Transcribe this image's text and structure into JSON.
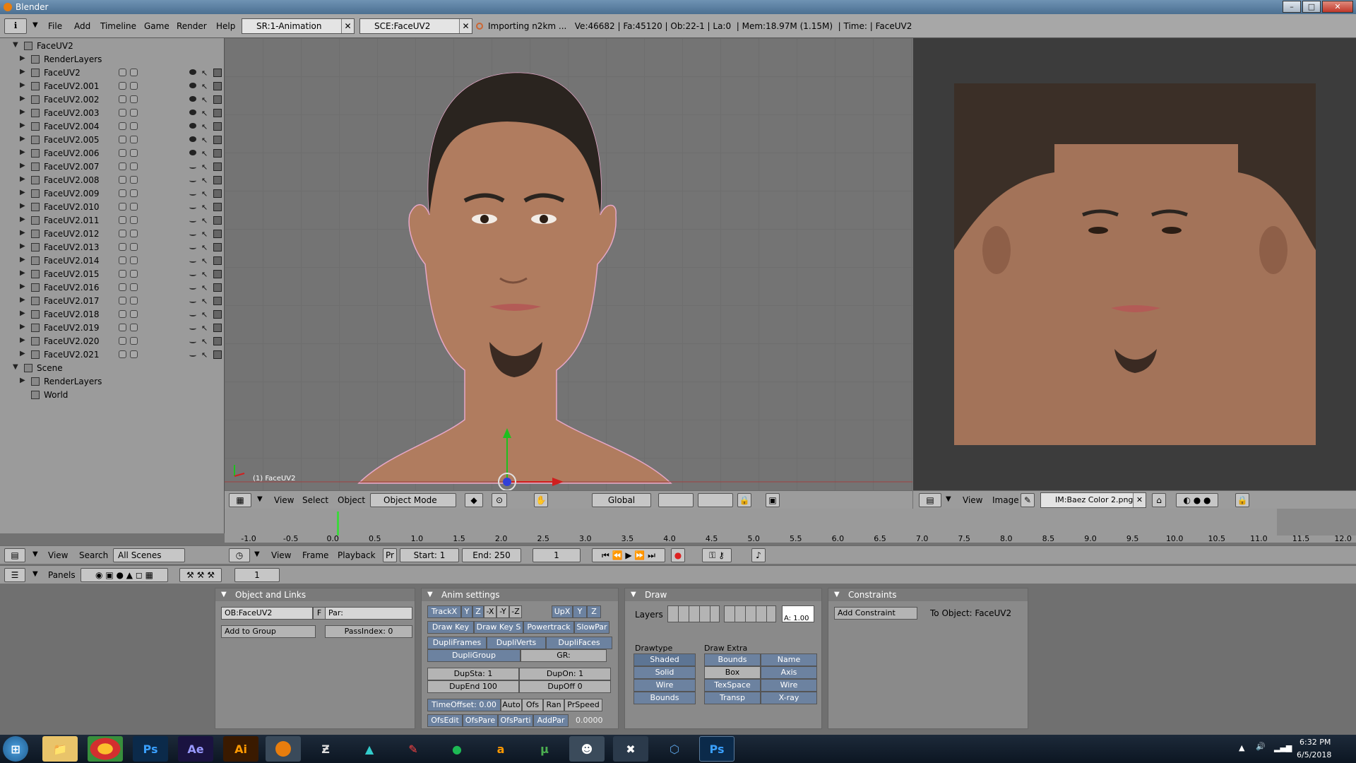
{
  "window": {
    "title": "Blender",
    "min": "–",
    "max": "□",
    "close": "✕"
  },
  "menu": {
    "items": [
      "File",
      "Add",
      "Timeline",
      "Game",
      "Render",
      "Help"
    ],
    "screen": "SR:1-Animation",
    "scene": "SCE:FaceUV2",
    "status": "Importing n2km ...   Ve:46682 | Fa:45120 | Ob:22-1 | La:0  | Mem:18.97M (1.15M)  | Time: | FaceUV2"
  },
  "outliner": {
    "root": "FaceUV2",
    "renderlayers": "RenderLayers",
    "objects": [
      "FaceUV2",
      "FaceUV2.001",
      "FaceUV2.002",
      "FaceUV2.003",
      "FaceUV2.004",
      "FaceUV2.005",
      "FaceUV2.006",
      "FaceUV2.007",
      "FaceUV2.008",
      "FaceUV2.009",
      "FaceUV2.010",
      "FaceUV2.011",
      "FaceUV2.012",
      "FaceUV2.013",
      "FaceUV2.014",
      "FaceUV2.015",
      "FaceUV2.016",
      "FaceUV2.017",
      "FaceUV2.018",
      "FaceUV2.019",
      "FaceUV2.020",
      "FaceUV2.021"
    ],
    "visible_count": 7,
    "scene": "Scene",
    "scene_renderlayers": "RenderLayers",
    "world": "World",
    "header": {
      "view": "View",
      "search": "Search",
      "filter": "All Scenes"
    }
  },
  "viewport": {
    "object_label": "(1) FaceUV2",
    "header": {
      "view": "View",
      "select": "Select",
      "object": "Object",
      "mode": "Object Mode",
      "orient": "Global"
    }
  },
  "imageview": {
    "header": {
      "view": "View",
      "image": "Image",
      "file": "IM:Baez Color 2.png"
    }
  },
  "timeline": {
    "ticks": [
      "-1.0",
      "-0.5",
      "0.0",
      "0.5",
      "1.0",
      "1.5",
      "2.0",
      "2.5",
      "3.0",
      "3.5",
      "4.0",
      "4.5",
      "5.0",
      "5.5",
      "6.0",
      "6.5",
      "7.0",
      "7.5",
      "8.0",
      "8.5",
      "9.0",
      "9.5",
      "10.0",
      "10.5",
      "11.0",
      "11.5",
      "12.0"
    ],
    "header": {
      "view": "View",
      "frame": "Frame",
      "playback": "Playback",
      "pr": "Pr",
      "start": "Start: 1",
      "end": "End: 250",
      "current": "1"
    }
  },
  "buttons": {
    "panels": "Panels",
    "frame": "1",
    "object_links": {
      "title": "Object and Links",
      "ob": "OB:FaceUV2",
      "f": "F",
      "par": "Par:",
      "add_group": "Add to Group",
      "passindex": "PassIndex: 0"
    },
    "anim": {
      "title": "Anim settings",
      "track": [
        "TrackX",
        "Y",
        "Z",
        "-X",
        "-Y",
        "-Z"
      ],
      "up": [
        "UpX",
        "Y",
        "Z"
      ],
      "row2": [
        "Draw Key",
        "Draw Key S",
        "Powertrack",
        "SlowPar"
      ],
      "row3": [
        "DupliFrames",
        "DupliVerts",
        "DupliFaces"
      ],
      "dupligroup": "DupliGroup",
      "gr": "GR:",
      "dupsta": "DupSta: 1",
      "dupon": "DupOn: 1",
      "dupend": "DupEnd 100",
      "dupoff": "DupOff 0",
      "row6": [
        "TimeOffset: 0.00",
        "Auto",
        "Ofs",
        "Ran",
        "PrSpeed"
      ],
      "row7": [
        "OfsEdit",
        "OfsPare",
        "OfsParti",
        "AddPar"
      ],
      "val": "0.0000"
    },
    "draw": {
      "title": "Draw",
      "layers": "Layers",
      "alpha": "A: 1.00",
      "drawtype": "Drawtype",
      "drawextra": "Draw Extra",
      "types": [
        "Shaded",
        "Solid",
        "Wire",
        "Bounds"
      ],
      "extra": [
        [
          "Bounds",
          "Name"
        ],
        [
          "Box",
          "Axis"
        ],
        [
          "TexSpace",
          "Wire"
        ],
        [
          "Transp",
          "X-ray"
        ]
      ]
    },
    "constraints": {
      "title": "Constraints",
      "add": "Add Constraint",
      "to": "To Object: FaceUV2"
    }
  },
  "taskbar": {
    "apps": [
      "Ps",
      "Ae",
      "Ai",
      "Ps"
    ],
    "time": "6:32 PM",
    "date": "6/5/2018"
  },
  "colors": {
    "skin": "#b07c5f",
    "hair": "#2a241f",
    "accent": "#6c82a0"
  }
}
